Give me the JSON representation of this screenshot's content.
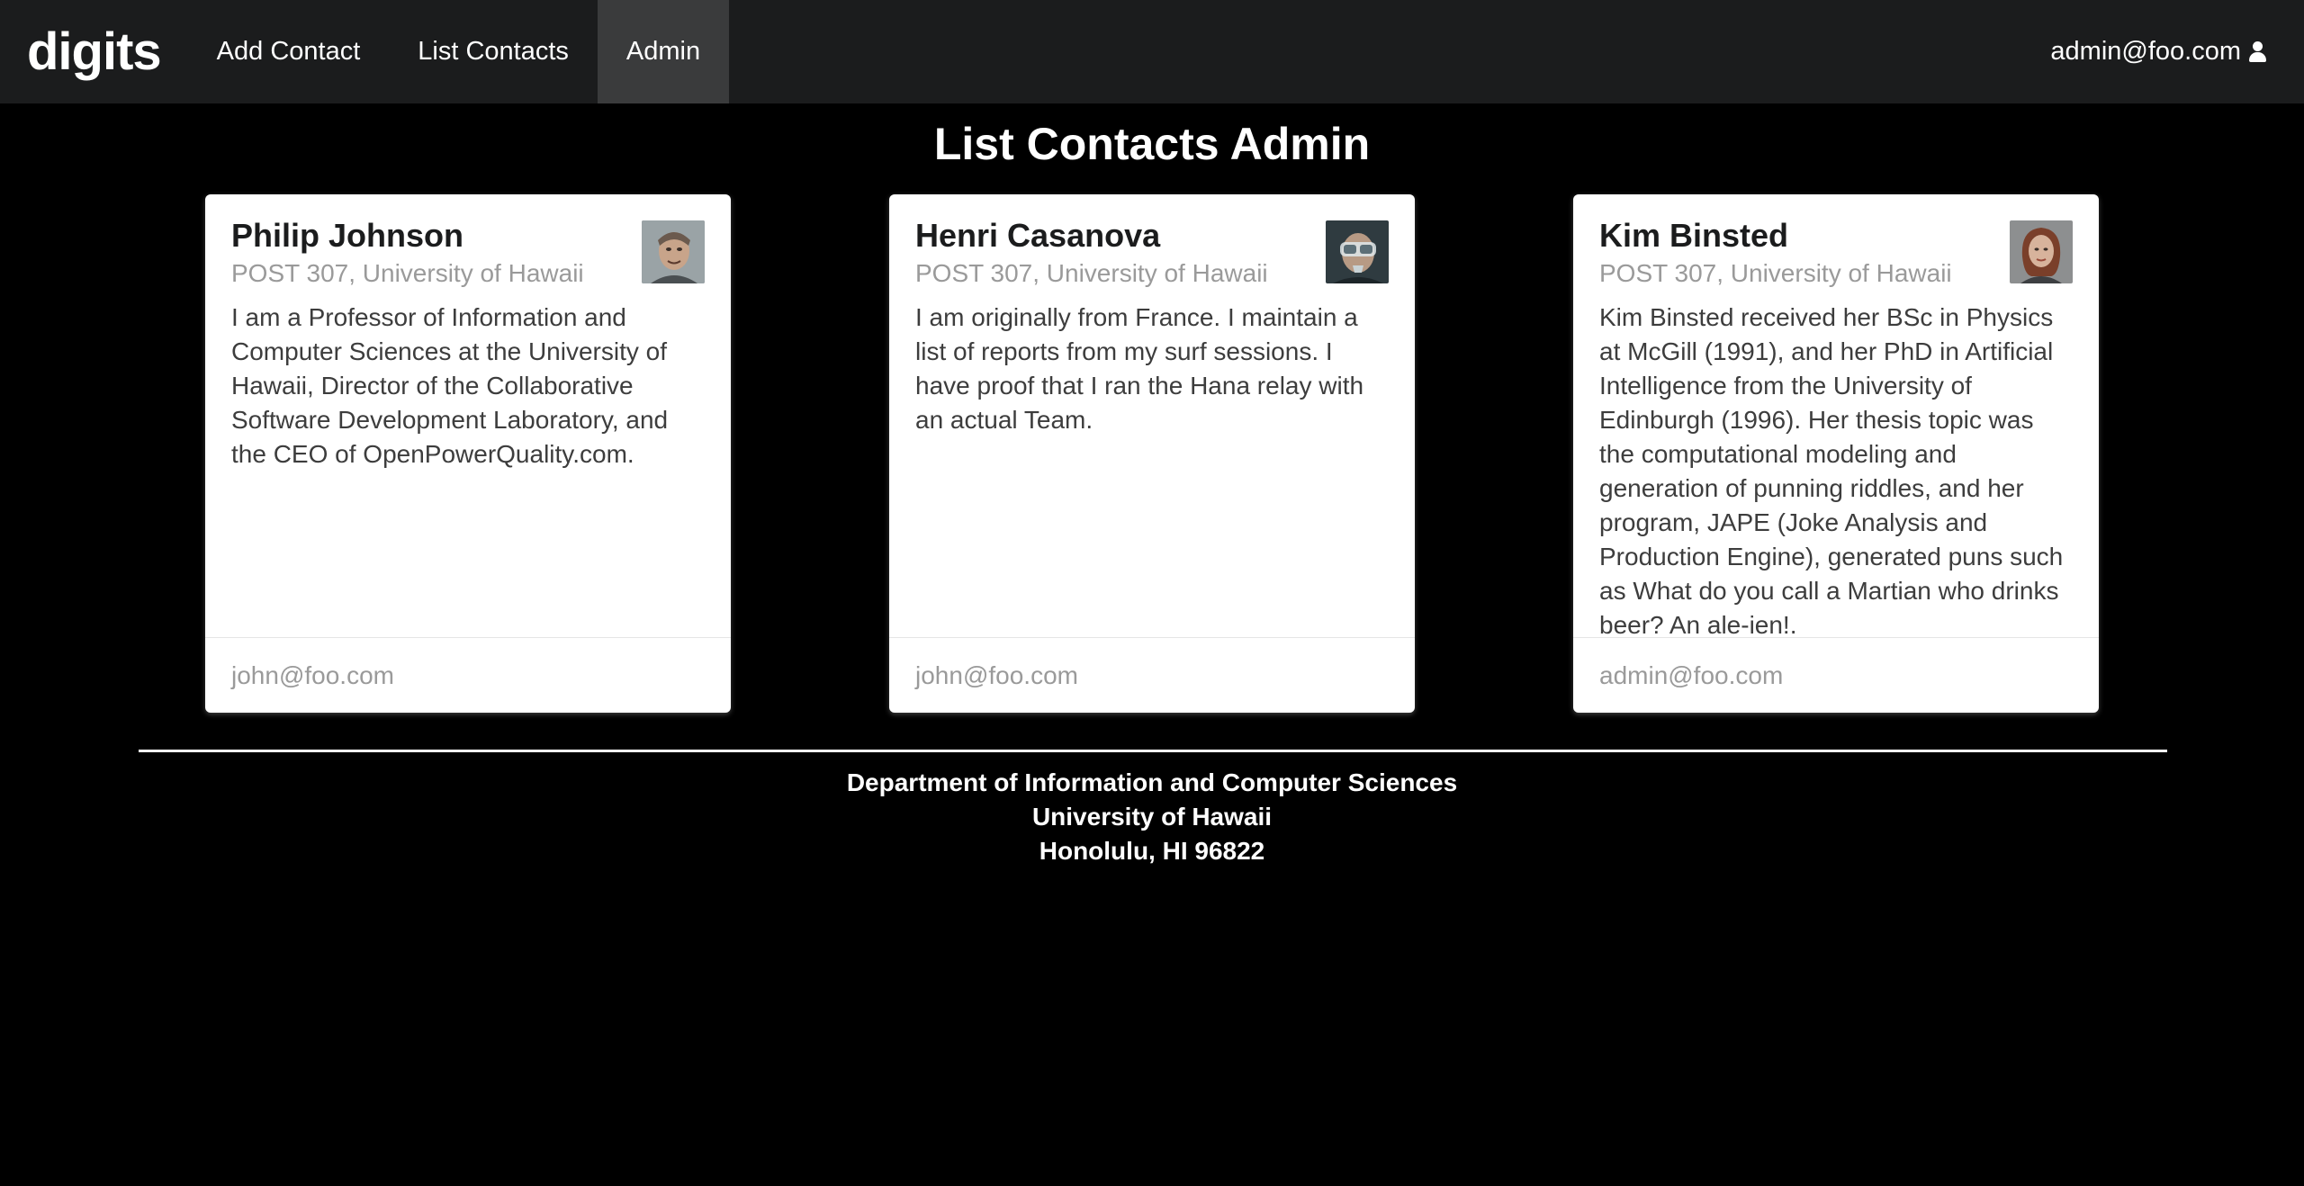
{
  "navbar": {
    "brand": "digits",
    "items": [
      {
        "label": "Add Contact",
        "active": false
      },
      {
        "label": "List Contacts",
        "active": false
      },
      {
        "label": "Admin",
        "active": true
      }
    ],
    "user": {
      "email": "admin@foo.com",
      "icon": "user-icon"
    }
  },
  "page": {
    "title": "List Contacts Admin"
  },
  "contacts": [
    {
      "name": "Philip Johnson",
      "address": "POST 307, University of Hawaii",
      "description": "I am a Professor of Information and Computer Sciences at the University of Hawaii, Director of the Collaborative Software Development Laboratory, and the CEO of OpenPowerQuality.com.",
      "owner": "john@foo.com"
    },
    {
      "name": "Henri Casanova",
      "address": "POST 307, University of Hawaii",
      "description": "I am originally from France. I maintain a list of reports from my surf sessions. I have proof that I ran the Hana relay with an actual Team.",
      "owner": "john@foo.com"
    },
    {
      "name": "Kim Binsted",
      "address": "POST 307, University of Hawaii",
      "description": "Kim Binsted received her BSc in Physics at McGill (1991), and her PhD in Artificial Intelligence from the University of Edinburgh (1996). Her thesis topic was the computational modeling and generation of punning riddles, and her program, JAPE (Joke Analysis and Production Engine), generated puns such as What do you call a Martian who drinks beer? An ale-ien!.",
      "owner": "admin@foo.com"
    }
  ],
  "footer": {
    "line1": "Department of Information and Computer Sciences",
    "line2": "University of Hawaii",
    "line3": "Honolulu, HI 96822"
  },
  "colors": {
    "background": "#000000",
    "navbar": "#1b1c1d",
    "navbar_active": "#3a3b3c",
    "card": "#ffffff",
    "meta_text": "#9a9a9a"
  }
}
